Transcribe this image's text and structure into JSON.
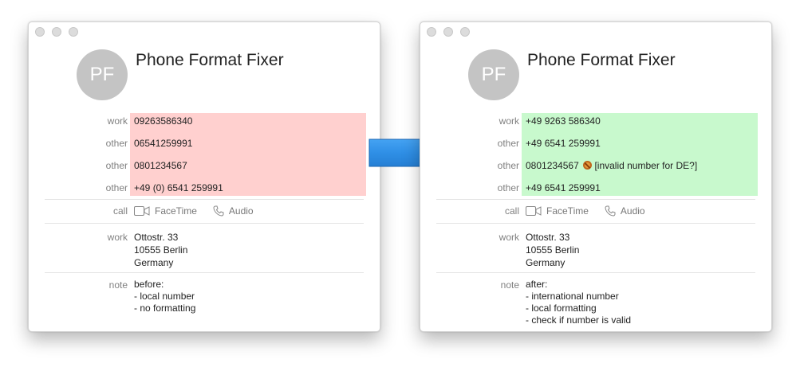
{
  "windows": [
    {
      "avatar": "PF",
      "title": "Phone Format Fixer",
      "phones": [
        {
          "label": "work",
          "value": "09263586340"
        },
        {
          "label": "other",
          "value": "06541259991"
        },
        {
          "label": "other",
          "value": "0801234567"
        },
        {
          "label": "other",
          "value": "+49 (0) 6541 259991"
        }
      ],
      "call": {
        "label": "call",
        "facetime": "FaceTime",
        "audio": "Audio"
      },
      "address": {
        "label": "work",
        "value": "Ottostr. 33\n10555 Berlin\nGermany"
      },
      "note": {
        "label": "note",
        "value": "before:\n- local number\n- no formatting"
      },
      "highlight_color": "#ffd0cf"
    },
    {
      "avatar": "PF",
      "title": "Phone Format Fixer",
      "phones": [
        {
          "label": "work",
          "value": "+49 9263 586340"
        },
        {
          "label": "other",
          "value": "+49 6541 259991"
        },
        {
          "label": "other",
          "value": "0801234567",
          "warning": "[invalid number for DE?]"
        },
        {
          "label": "other",
          "value": "+49 6541 259991"
        }
      ],
      "call": {
        "label": "call",
        "facetime": "FaceTime",
        "audio": "Audio"
      },
      "address": {
        "label": "work",
        "value": "Ottostr. 33\n10555 Berlin\nGermany"
      },
      "note": {
        "label": "note",
        "value": "after:\n- international number\n- local formatting\n- check if number is valid"
      },
      "highlight_color": "#c8f9cd"
    }
  ],
  "arrow": {
    "direction": "right",
    "color": "#2f8fe6"
  }
}
